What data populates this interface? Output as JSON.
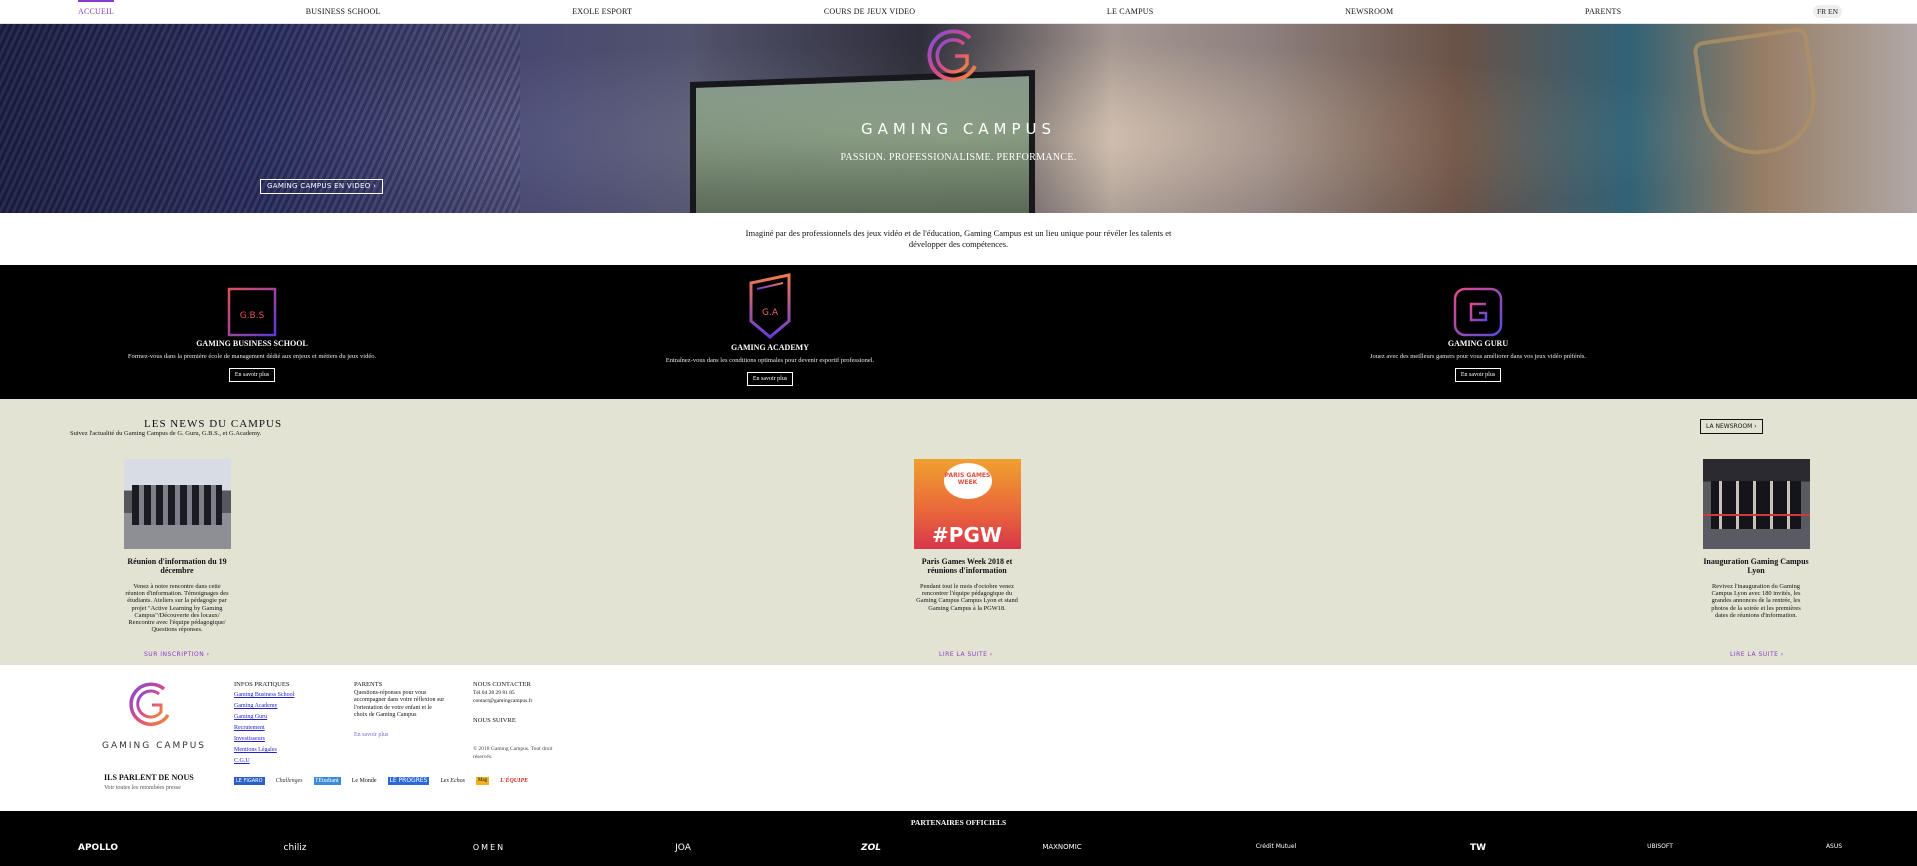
{
  "nav": {
    "items": [
      "ACCUEIL",
      "BUSINESS SCHOOL",
      "EXOLE ESPORT",
      "COURS DE JEUX VIDEO",
      "LE CAMPUS",
      "NEWSROOM",
      "PARENTS"
    ],
    "lang": "FR EN"
  },
  "hero": {
    "title": "GAMING CAMPUS",
    "tagline": "PASSION. PROFESSIONALISME. PERFORMANCE.",
    "video_button": "GAMING CAMPUS EN VIDEO ›"
  },
  "intro": "Imaginé par des professionnels des jeux vidéo et de l'éducation, Gaming Campus est un lieu unique pour révéler les talents et développer des compétences.",
  "schools": [
    {
      "icon": "G.B.S",
      "title": "GAMING BUSINESS SCHOOL",
      "desc": "Formez-vous dans la première école de management dédié aux enjeux et métiers du jeux vidéo.",
      "button": "En savoir plus"
    },
    {
      "icon": "G.A",
      "title": "GAMING ACADEMY",
      "desc": "Entraînez-vous dans les conditions optimales pour devenir esportif professionel.",
      "button": "En savoir plus"
    },
    {
      "icon": "G",
      "title": "GAMING GURU",
      "desc": "Jouez avec des meilleurs gamers pour vous améliorer dans vos jeux vidéo préférés.",
      "button": "En savoir plus"
    }
  ],
  "news": {
    "title": "LES NEWS DU CAMPUS",
    "subtitle": "Suivez l'actualité du Gaming Campus de G. Guru, G.B.S., et G.Academy.",
    "newsroom_button": "LA NEWSROOM ›",
    "cards": [
      {
        "title": "Réunion d'information du 19 décembre",
        "text": "Venez à notre rencontre dans cette réunion d'information. Témoignages des étudiants. Ateliers sur la pédagogie par projet \"Active Learning by Gaming Campus\"/Découverte des locaux/ Rencontre avec l'équipe pédagogique/ Questions réponses.",
        "link": "SUR INSCRIPTION ›"
      },
      {
        "title": "Paris Games Week 2018 et réunions d'information",
        "text": "Pendant tout le mois d'octobre venez rencontrer l'équipe pédagogique du Gaming Campus Campus Lyon et stand Gaming Campus à la PGW18.",
        "link": "LIRE LA SUITE ›",
        "thumb_text": "#PGW",
        "badge_text": "PARIS GAMES WEEK"
      },
      {
        "title": "Inauguration Gaming Campus Lyon",
        "text": "Revivez l'inauguration du Gaming Campus Lyon avec 180 invités, les grandes annonces de la rentrée, les photos de la soirée et les premières dates de réunions d'information.",
        "link": "LIRE LA SUITE ›"
      }
    ]
  },
  "footer": {
    "logo_text": "GAMING CAMPUS",
    "infos_title": "INFOS PRATIQUES",
    "infos_links": [
      "Gaming Business School",
      "Gaming Academy",
      "Gaming Guru",
      "Recrutement",
      "Investisseurs",
      "Mentions Légales",
      "C.G.U"
    ],
    "parents_title": "PARENTS",
    "parents_text": "Questions-réponses pour vous accompagner dans votre réflexion sur l'orientation de votre enfant et le choix de Gaming Campus",
    "parents_link": "En savoir plus",
    "contact_title": "NOUS CONTACTER",
    "contact_phone": "Tél 04 28 29 81 85",
    "contact_email": "contact@gamingcampus.fr",
    "follow_title": "NOUS SUIVRE",
    "copyright": "© 2018 Gaming Campus. Tout droit réservés.",
    "parlent_title": "ILS PARLENT DE NOUS",
    "parlent_sub": "Voir toutes les retombées presse",
    "press": [
      "LE FIGARO",
      "Challenges",
      "l'Étudiant",
      "Le Monde",
      "LE PROGRÈS",
      "Les Echos",
      "Mag",
      "L'ÉQUIPE"
    ]
  },
  "partners": {
    "title": "PARTENAIRES OFFICIELS",
    "logos": [
      "APOLLO",
      "chiliz",
      "OMEN",
      "JOA",
      "ZOL",
      "MAXNOMIC",
      "Crédit Mutuel",
      "TW",
      "UBISOFT",
      "ASUS"
    ]
  },
  "colors": {
    "accent": "#8b3ac9",
    "black": "#000000",
    "news_bg": "#e3e3d4"
  }
}
